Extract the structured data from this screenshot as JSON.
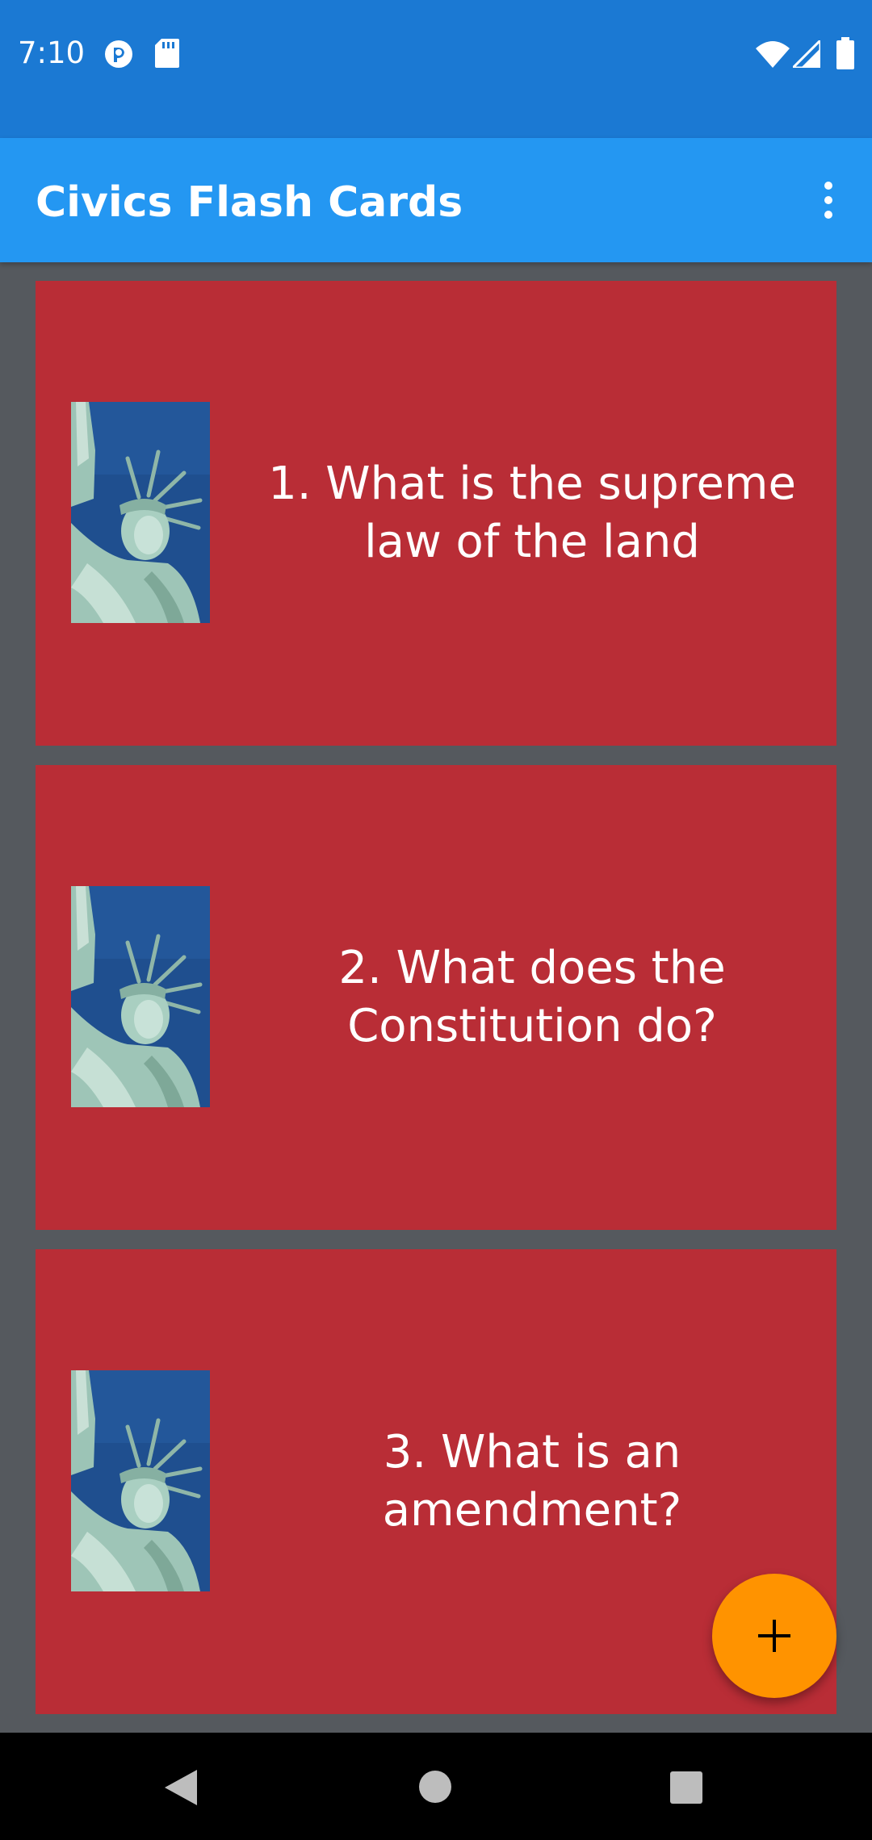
{
  "status_bar": {
    "time": "7:10",
    "icons": [
      "pocket-casts-icon",
      "sd-card-icon",
      "wifi-icon",
      "signal-icon",
      "battery-icon"
    ]
  },
  "app_bar": {
    "title": "Civics Flash Cards",
    "menu_icon": "more-vert-icon"
  },
  "cards": [
    {
      "text": "1. What is the supreme law of the land",
      "image": "statue-of-liberty"
    },
    {
      "text": "2. What does the Constitution do?",
      "image": "statue-of-liberty"
    },
    {
      "text": "3. What is an amendment?",
      "image": "statue-of-liberty"
    }
  ],
  "fab": {
    "icon": "plus-icon"
  },
  "nav_bar": {
    "icons": [
      "back-icon",
      "home-icon",
      "recents-icon"
    ]
  },
  "colors": {
    "status_bar": "#1b79d3",
    "app_bar": "#2497f2",
    "card": "#b92d36",
    "background": "#55595e",
    "fab": "#ff9300"
  }
}
